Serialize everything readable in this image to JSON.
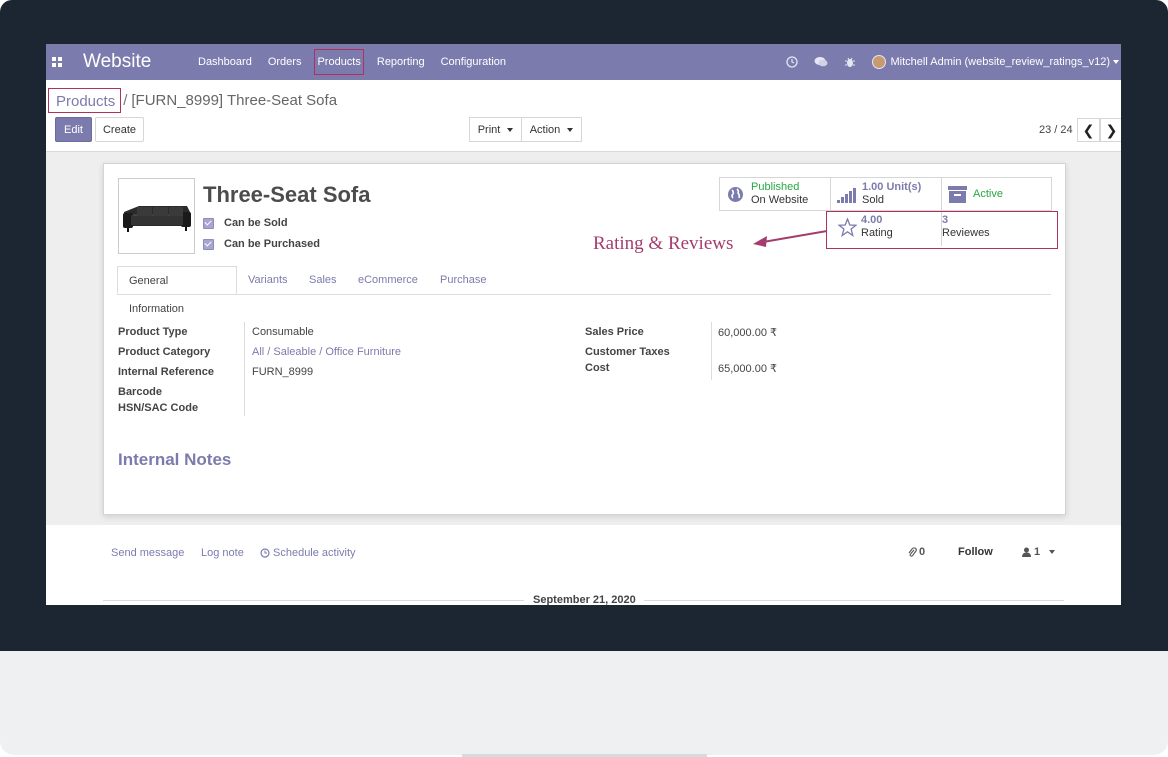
{
  "navbar": {
    "brand": "Website",
    "menu": [
      "Dashboard",
      "Orders",
      "Products",
      "Reporting",
      "Configuration"
    ],
    "user": "Mitchell Admin (website_review_ratings_v12)",
    "icons": [
      "clock-icon",
      "chat-icon",
      "bug-icon"
    ]
  },
  "breadcrumb": {
    "parent": "Products",
    "separator": "/",
    "current": "[FURN_8999] Three-Seat Sofa"
  },
  "toolbar": {
    "edit": "Edit",
    "create": "Create",
    "print": "Print",
    "action": "Action"
  },
  "pager": {
    "value": "23 / 24",
    "prev": "❮",
    "next": "❯"
  },
  "product": {
    "name": "Three-Seat Sofa",
    "can_be_sold": "Can be Sold",
    "can_be_purchased": "Can be Purchased"
  },
  "smart_buttons": {
    "published": {
      "top": "Published",
      "bottom": "On Website"
    },
    "sold": {
      "top": "1.00 Unit(s)",
      "bottom": "Sold"
    },
    "active": {
      "label": "Active"
    },
    "rating": {
      "top": "4.00",
      "bottom": "Rating"
    },
    "reviews": {
      "top": "3",
      "bottom": "Reviewes"
    }
  },
  "annotation": "Rating & Reviews",
  "tabs": [
    "General Information",
    "Variants",
    "Sales",
    "eCommerce",
    "Purchase"
  ],
  "fields_left": [
    {
      "label": "Product Type",
      "value": "Consumable"
    },
    {
      "label": "Product Category",
      "value": "All / Saleable / Office Furniture"
    },
    {
      "label": "Internal Reference",
      "value": "FURN_8999"
    },
    {
      "label": "Barcode",
      "value": ""
    },
    {
      "label": "HSN/SAC Code",
      "value": ""
    }
  ],
  "fields_right": [
    {
      "label": "Sales Price",
      "value": "60,000.00 ₹"
    },
    {
      "label": "Customer Taxes",
      "value": ""
    },
    {
      "label": "Cost",
      "value": "65,000.00 ₹"
    }
  ],
  "notes_title": "Internal Notes",
  "chatter": {
    "send_message": "Send message",
    "log_note": "Log note",
    "schedule_activity": "Schedule activity",
    "attachments": "0",
    "follow": "Follow",
    "followers": "1",
    "date": "September 21, 2020"
  },
  "colors": {
    "primary": "#7c7bad",
    "highlight": "#b0305f",
    "success": "#28a745"
  }
}
